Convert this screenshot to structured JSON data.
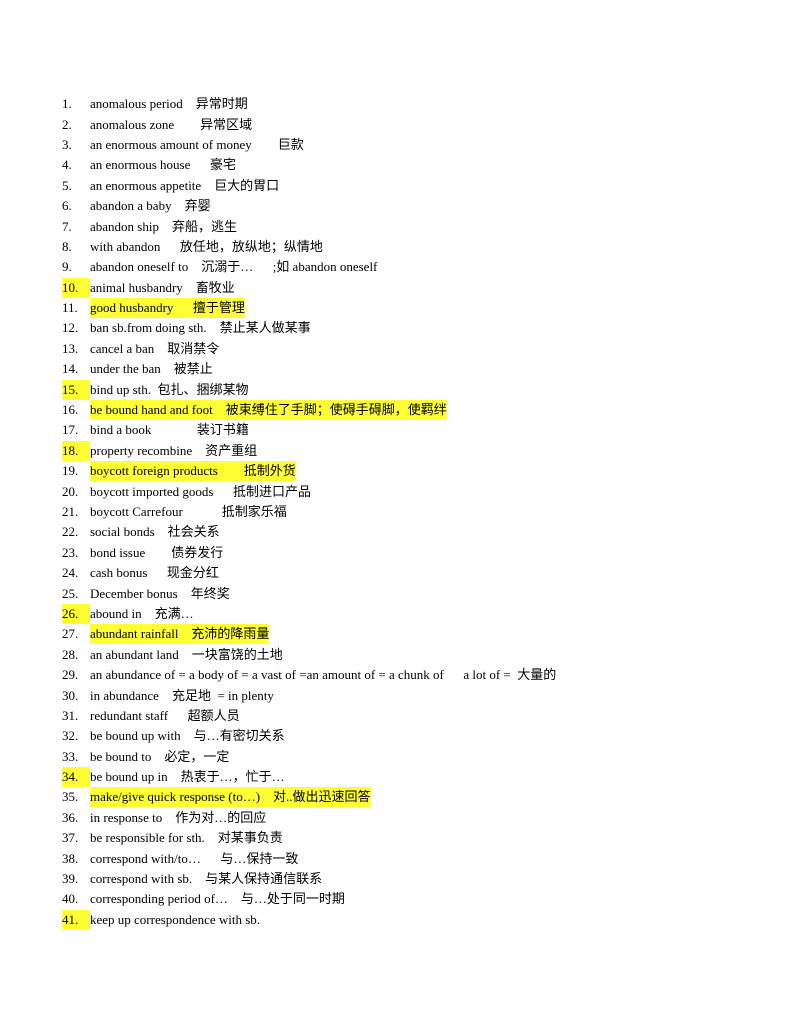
{
  "document": {
    "highlight_color": "#ffff33",
    "items": [
      {
        "num": "1.",
        "text": "anomalous period    异常时期",
        "hl_num": false,
        "hl_text": false
      },
      {
        "num": "2.",
        "text": "anomalous zone        异常区域",
        "hl_num": false,
        "hl_text": false
      },
      {
        "num": "3.",
        "text": "an enormous amount of money        巨款",
        "hl_num": false,
        "hl_text": false
      },
      {
        "num": "4.",
        "text": "an enormous house      豪宅",
        "hl_num": false,
        "hl_text": false
      },
      {
        "num": "5.",
        "text": "an enormous appetite    巨大的胃口",
        "hl_num": false,
        "hl_text": false
      },
      {
        "num": "6.",
        "text": "abandon a baby    弃婴",
        "hl_num": false,
        "hl_text": false
      },
      {
        "num": "7.",
        "text": "abandon ship    弃船，逃生",
        "hl_num": false,
        "hl_text": false
      },
      {
        "num": "8.",
        "text": "with abandon      放任地，放纵地；纵情地",
        "hl_num": false,
        "hl_text": false
      },
      {
        "num": "9.",
        "text": "abandon oneself to    沉溺于…      ;如 abandon oneself",
        "hl_num": false,
        "hl_text": false
      },
      {
        "num": "10.",
        "text": "animal husbandry    畜牧业",
        "hl_num": true,
        "hl_text": false
      },
      {
        "num": "11.",
        "text": "good husbandry      擅于管理",
        "hl_num": false,
        "hl_text": true
      },
      {
        "num": "12.",
        "text": "ban sb.from doing sth.    禁止某人做某事",
        "hl_num": false,
        "hl_text": false
      },
      {
        "num": "13.",
        "text": "cancel a ban    取消禁令",
        "hl_num": false,
        "hl_text": false
      },
      {
        "num": "14.",
        "text": "under the ban    被禁止",
        "hl_num": false,
        "hl_text": false
      },
      {
        "num": "15.",
        "text": "bind up sth.  包扎、捆绑某物",
        "hl_num": true,
        "hl_text": false
      },
      {
        "num": "16.",
        "text": "be bound hand and foot    被束缚住了手脚；使碍手碍脚，使羁绊",
        "hl_num": false,
        "hl_text": true
      },
      {
        "num": "17.",
        "text": "bind a book              装订书籍",
        "hl_num": false,
        "hl_text": false
      },
      {
        "num": "18.",
        "text": "property recombine    资产重组",
        "hl_num": true,
        "hl_text": false
      },
      {
        "num": "19.",
        "text": "boycott foreign products        抵制外货",
        "hl_num": false,
        "hl_text": true
      },
      {
        "num": "20.",
        "text": "boycott imported goods      抵制进口产品",
        "hl_num": false,
        "hl_text": false
      },
      {
        "num": "21.",
        "text": "boycott Carrefour            抵制家乐福",
        "hl_num": false,
        "hl_text": false
      },
      {
        "num": "22.",
        "text": "social bonds    社会关系",
        "hl_num": false,
        "hl_text": false
      },
      {
        "num": "23.",
        "text": "bond issue        债券发行",
        "hl_num": false,
        "hl_text": false
      },
      {
        "num": "24.",
        "text": "cash bonus      现金分红",
        "hl_num": false,
        "hl_text": false
      },
      {
        "num": "25.",
        "text": "December bonus    年终奖",
        "hl_num": false,
        "hl_text": false
      },
      {
        "num": "26.",
        "text": "abound in    充满…",
        "hl_num": true,
        "hl_text": false
      },
      {
        "num": "27.",
        "text": "abundant rainfall    充沛的降雨量",
        "hl_num": false,
        "hl_text": true
      },
      {
        "num": "28.",
        "text": "an abundant land    一块富饶的土地",
        "hl_num": false,
        "hl_text": false
      },
      {
        "num": "29.",
        "text": "an abundance of = a body of = a vast of =an amount of = a chunk of      a lot of =  大量的",
        "hl_num": false,
        "hl_text": false
      },
      {
        "num": "30.",
        "text": "in abundance    充足地  = in plenty",
        "hl_num": false,
        "hl_text": false
      },
      {
        "num": "31.",
        "text": "redundant staff      超额人员",
        "hl_num": false,
        "hl_text": false
      },
      {
        "num": "32.",
        "text": "be bound up with    与…有密切关系",
        "hl_num": false,
        "hl_text": false
      },
      {
        "num": "33.",
        "text": "be bound to    必定，一定",
        "hl_num": false,
        "hl_text": false
      },
      {
        "num": "34.",
        "text": "be bound up in    热衷于…，忙于…",
        "hl_num": true,
        "hl_text": false
      },
      {
        "num": "35.",
        "text": "make/give quick response (to…)    对..做出迅速回答",
        "hl_num": false,
        "hl_text": true
      },
      {
        "num": "36.",
        "text": "in response to    作为对…的回应",
        "hl_num": false,
        "hl_text": false
      },
      {
        "num": "37.",
        "text": "be responsible for sth.    对某事负责",
        "hl_num": false,
        "hl_text": false
      },
      {
        "num": "38.",
        "text": "correspond with/to…      与…保持一致",
        "hl_num": false,
        "hl_text": false
      },
      {
        "num": "39.",
        "text": "correspond with sb.    与某人保持通信联系",
        "hl_num": false,
        "hl_text": false
      },
      {
        "num": "40.",
        "text": "corresponding period of…    与…处于同一时期",
        "hl_num": false,
        "hl_text": false
      },
      {
        "num": "41.",
        "text": "keep up correspondence with sb.",
        "hl_num": true,
        "hl_text": false
      }
    ]
  }
}
